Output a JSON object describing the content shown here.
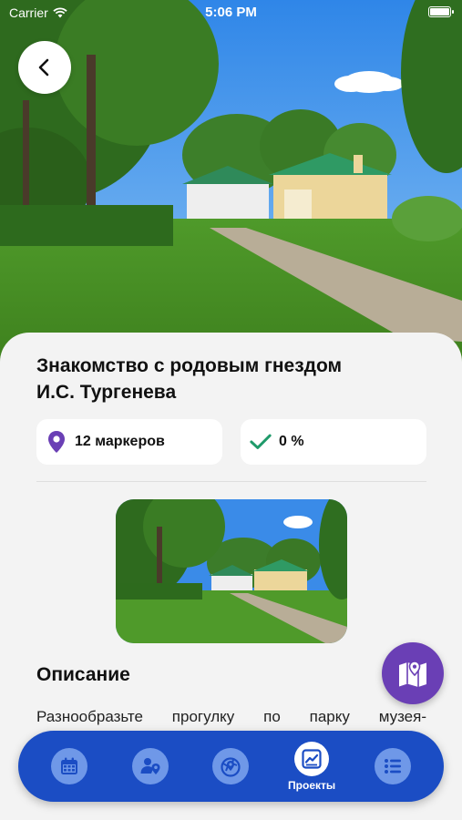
{
  "status_bar": {
    "carrier": "Carrier",
    "time": "5:06 PM"
  },
  "header": {
    "back_icon": "chevron-left-icon"
  },
  "tour": {
    "title_line1": "Знакомство с родовым гнездом",
    "title_line2": "И.С. Тургенева",
    "markers_label": "12 маркеров",
    "progress_label": "0 %",
    "markers_icon": "map-pin-icon",
    "progress_icon": "checkmark-icon"
  },
  "description": {
    "title": "Описание",
    "text": "Разнообразьте прогулку по парку музея-"
  },
  "map_button": {
    "icon": "map-location-icon"
  },
  "tab_bar": {
    "tabs": [
      {
        "icon": "calendar-icon",
        "label": ""
      },
      {
        "icon": "user-location-icon",
        "label": ""
      },
      {
        "icon": "globe-pin-icon",
        "label": ""
      },
      {
        "icon": "projects-chart-icon",
        "label": "Проекты",
        "active": true
      },
      {
        "icon": "list-icon",
        "label": ""
      }
    ]
  },
  "colors": {
    "accent_blue": "#1b4dc4",
    "accent_purple": "#6a3fb5",
    "check_green": "#1f9a6a",
    "tab_icon_inactive": "#6f98e8"
  }
}
